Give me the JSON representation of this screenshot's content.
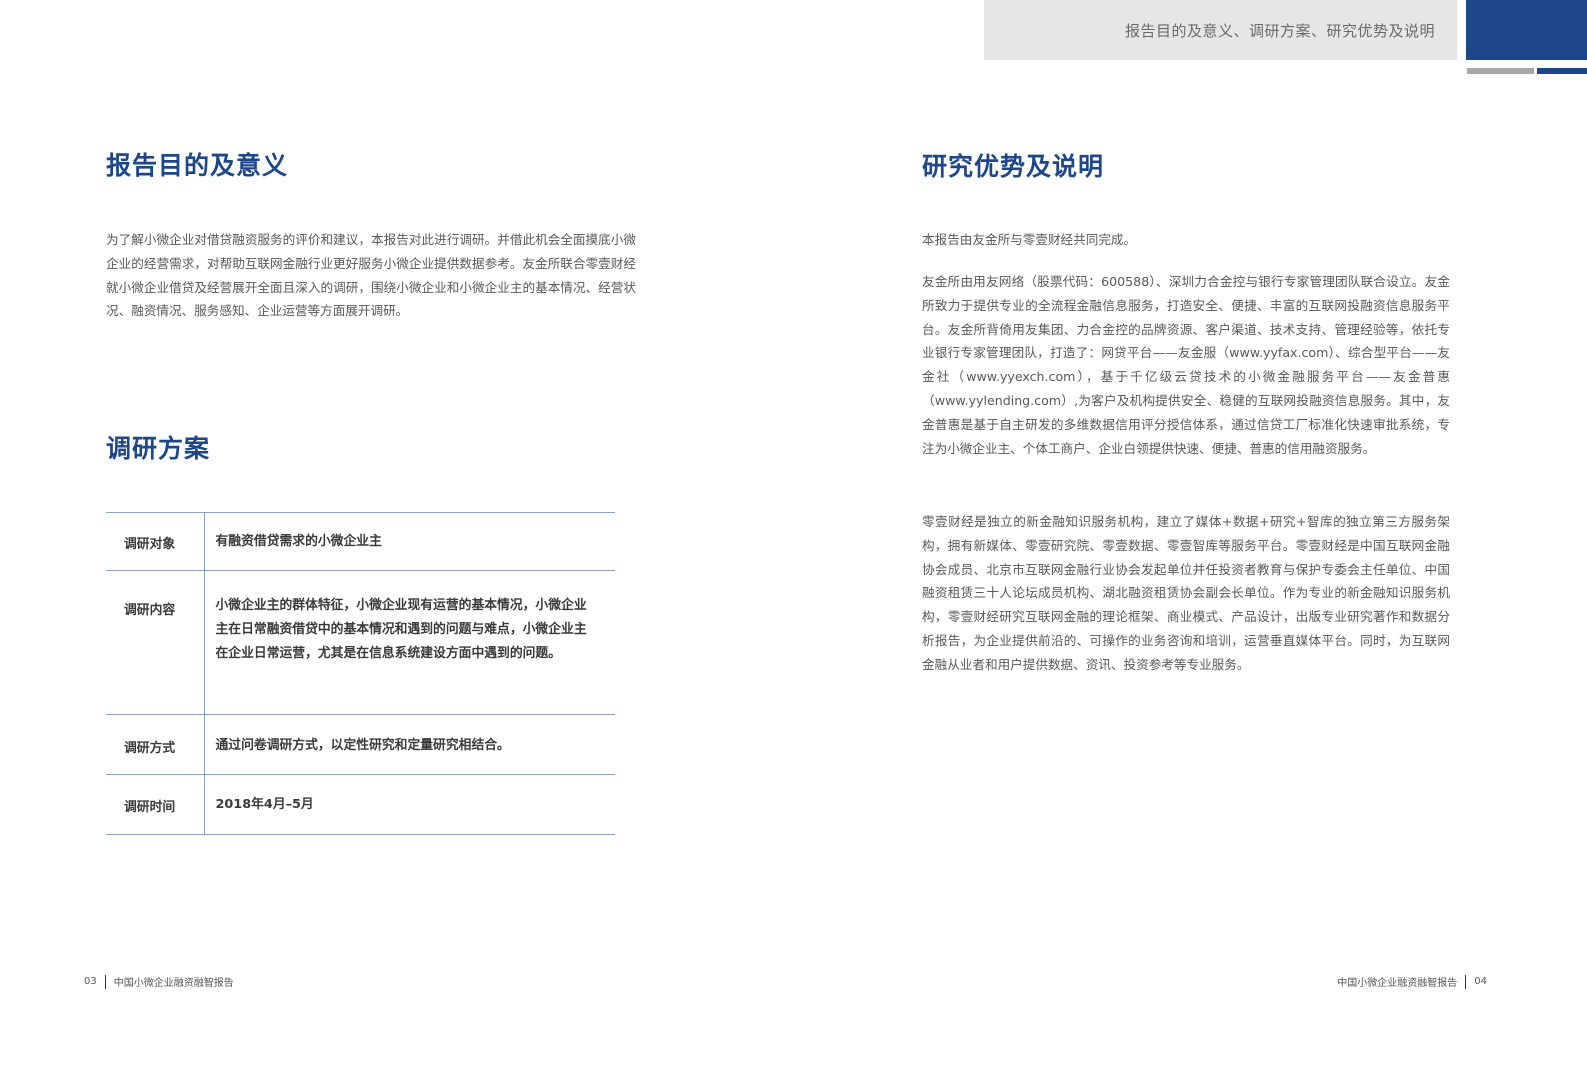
{
  "header": {
    "title": "报告目的及意义、调研方案、研究优势及说明",
    "accent_color": "#1d4789"
  },
  "left_page": {
    "purpose": {
      "heading": "报告目的及意义",
      "body": "为了解小微企业对借贷融资服务的评价和建议，本报告对此进行调研。并借此机会全面摸底小微企业的经营需求，对帮助互联网金融行业更好服务小微企业提供数据参考。友金所联合零壹财经就小微企业借贷及经营展开全面且深入的调研，围绕小微企业和小微企业主的基本情况、经营状况、融资情况、服务感知、企业运营等方面展开调研。"
    },
    "plan": {
      "heading": "调研方案",
      "rows": [
        {
          "key": "调研对象",
          "value": "有融资借贷需求的小微企业主"
        },
        {
          "key": "调研内容",
          "value": "小微企业主的群体特征，小微企业现有运营的基本情况，小微企业主在日常融资借贷中的基本情况和遇到的问题与难点，小微企业主在企业日常运营，尤其是在信息系统建设方面中遇到的问题。"
        },
        {
          "key": "调研方式",
          "value": "通过问卷调研方式，以定性研究和定量研究相结合。"
        },
        {
          "key": "调研时间",
          "value": "2018年4月–5月"
        }
      ]
    },
    "footer": {
      "page": "03",
      "title": "中国小微企业融资融智报告"
    }
  },
  "right_page": {
    "advantage": {
      "heading": "研究优势及说明",
      "paragraphs": [
        "本报告由友金所与零壹财经共同完成。",
        "友金所由用友网络（股票代码：600588）、深圳力合金控与银行专家管理团队联合设立。友金所致力于提供专业的全流程金融信息服务，打造安全、便捷、丰富的互联网投融资信息服务平台。友金所背倚用友集团、力合金控的品牌资源、客户渠道、技术支持、管理经验等，依托专业银行专家管理团队，打造了：网贷平台——友金服（www.yyfax.com）、综合型平台——友金社（www.yyexch.com），基于千亿级云贷技术的小微金融服务平台——友金普惠（www.yylending.com）,为客户及机构提供安全、稳健的互联网投融资信息服务。其中，友金普惠是基于自主研发的多维数据信用评分授信体系，通过信贷工厂标准化快速审批系统，专注为小微企业主、个体工商户、企业白领提供快速、便捷、普惠的信用融资服务。",
        "零壹财经是独立的新金融知识服务机构，建立了媒体+数据+研究+智库的独立第三方服务架构，拥有新媒体、零壹研究院、零壹数据、零壹智库等服务平台。零壹财经是中国互联网金融协会成员、北京市互联网金融行业协会发起单位并任投资者教育与保护专委会主任单位、中国融资租赁三十人论坛成员机构、湖北融资租赁协会副会长单位。作为专业的新金融知识服务机构，零壹财经研究互联网金融的理论框架、商业模式、产品设计，出版专业研究著作和数据分析报告，为企业提供前沿的、可操作的业务咨询和培训，运营垂直媒体平台。同时，为互联网金融从业者和用户提供数据、资讯、投资参考等专业服务。"
      ]
    },
    "footer": {
      "page": "04",
      "title": "中国小微企业融资融智报告"
    }
  }
}
